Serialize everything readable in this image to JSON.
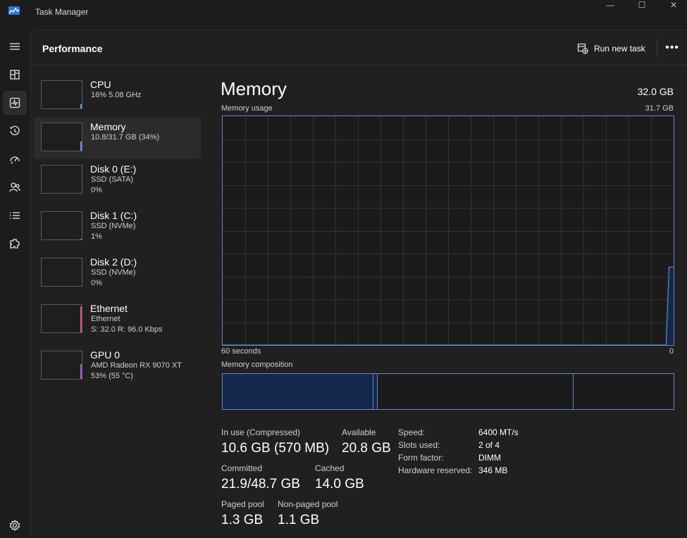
{
  "window": {
    "title": "Task Manager",
    "controls": {
      "minimize": "—",
      "maximize": "☐",
      "close": "✕"
    }
  },
  "nav": {
    "items": [
      {
        "icon": "hamburger-menu-icon"
      },
      {
        "icon": "processes-icon"
      },
      {
        "icon": "performance-icon",
        "active": true
      },
      {
        "icon": "app-history-icon"
      },
      {
        "icon": "startup-apps-icon"
      },
      {
        "icon": "users-icon"
      },
      {
        "icon": "details-icon"
      },
      {
        "icon": "services-icon"
      }
    ],
    "settings_icon": "settings-icon"
  },
  "header": {
    "title": "Performance",
    "run_new_task_label": "Run new task",
    "more_label": "•••"
  },
  "resources": [
    {
      "name": "CPU",
      "line1": "16%  5.08 GHz",
      "line2": "",
      "color": "#4fa3ff",
      "level": 0.16
    },
    {
      "name": "Memory",
      "line1": "10.8/31.7 GB (34%)",
      "line2": "",
      "color": "#6a9cf0",
      "level": 0.34,
      "active": true
    },
    {
      "name": "Disk 0 (E:)",
      "line1": "SSD (SATA)",
      "line2": "0%",
      "color": "#7ac142",
      "level": 0.0
    },
    {
      "name": "Disk 1 (C:)",
      "line1": "SSD (NVMe)",
      "line2": "1%",
      "color": "#7ac142",
      "level": 0.01
    },
    {
      "name": "Disk 2 (D:)",
      "line1": "SSD (NVMe)",
      "line2": "0%",
      "color": "#7ac142",
      "level": 0.0
    },
    {
      "name": "Ethernet",
      "line1": "Ethernet",
      "line2": "S: 32.0  R: 96.0 Kbps",
      "color": "#d65d8a",
      "level": 0.95
    },
    {
      "name": "GPU 0",
      "line1": "AMD Radeon RX 9070 XT",
      "line2": "53%  (55 °C)",
      "color": "#b05fd6",
      "level": 0.53
    }
  ],
  "detail": {
    "title": "Memory",
    "total": "32.0 GB",
    "usage_label": "Memory usage",
    "usage_max": "31.7 GB",
    "time_left": "60 seconds",
    "time_right": "0",
    "composition_label": "Memory composition",
    "accent": "#6688c6"
  },
  "chart_data": {
    "type": "area",
    "title": "Memory usage",
    "xlabel": "",
    "ylabel": "",
    "x": [
      60,
      1.0,
      0.6,
      0
    ],
    "values": [
      0,
      0,
      10.8,
      10.8
    ],
    "xlim": [
      60,
      0
    ],
    "ylim": [
      0,
      31.7
    ],
    "grid": true
  },
  "composition": {
    "in_use_fraction": 0.334,
    "modified_fraction": 0.01,
    "standby_fraction": 0.435,
    "free_fraction": 0.221
  },
  "stats": {
    "in_use_label": "In use (Compressed)",
    "in_use_value": "10.6 GB (570 MB)",
    "available_label": "Available",
    "available_value": "20.8 GB",
    "committed_label": "Committed",
    "committed_value": "21.9/48.7 GB",
    "cached_label": "Cached",
    "cached_value": "14.0 GB",
    "paged_label": "Paged pool",
    "paged_value": "1.3 GB",
    "nonpaged_label": "Non-paged pool",
    "nonpaged_value": "1.1 GB"
  },
  "specs": [
    {
      "label": "Speed:",
      "value": "6400 MT/s"
    },
    {
      "label": "Slots used:",
      "value": "2 of 4"
    },
    {
      "label": "Form factor:",
      "value": "DIMM"
    },
    {
      "label": "Hardware reserved:",
      "value": "346 MB"
    }
  ]
}
